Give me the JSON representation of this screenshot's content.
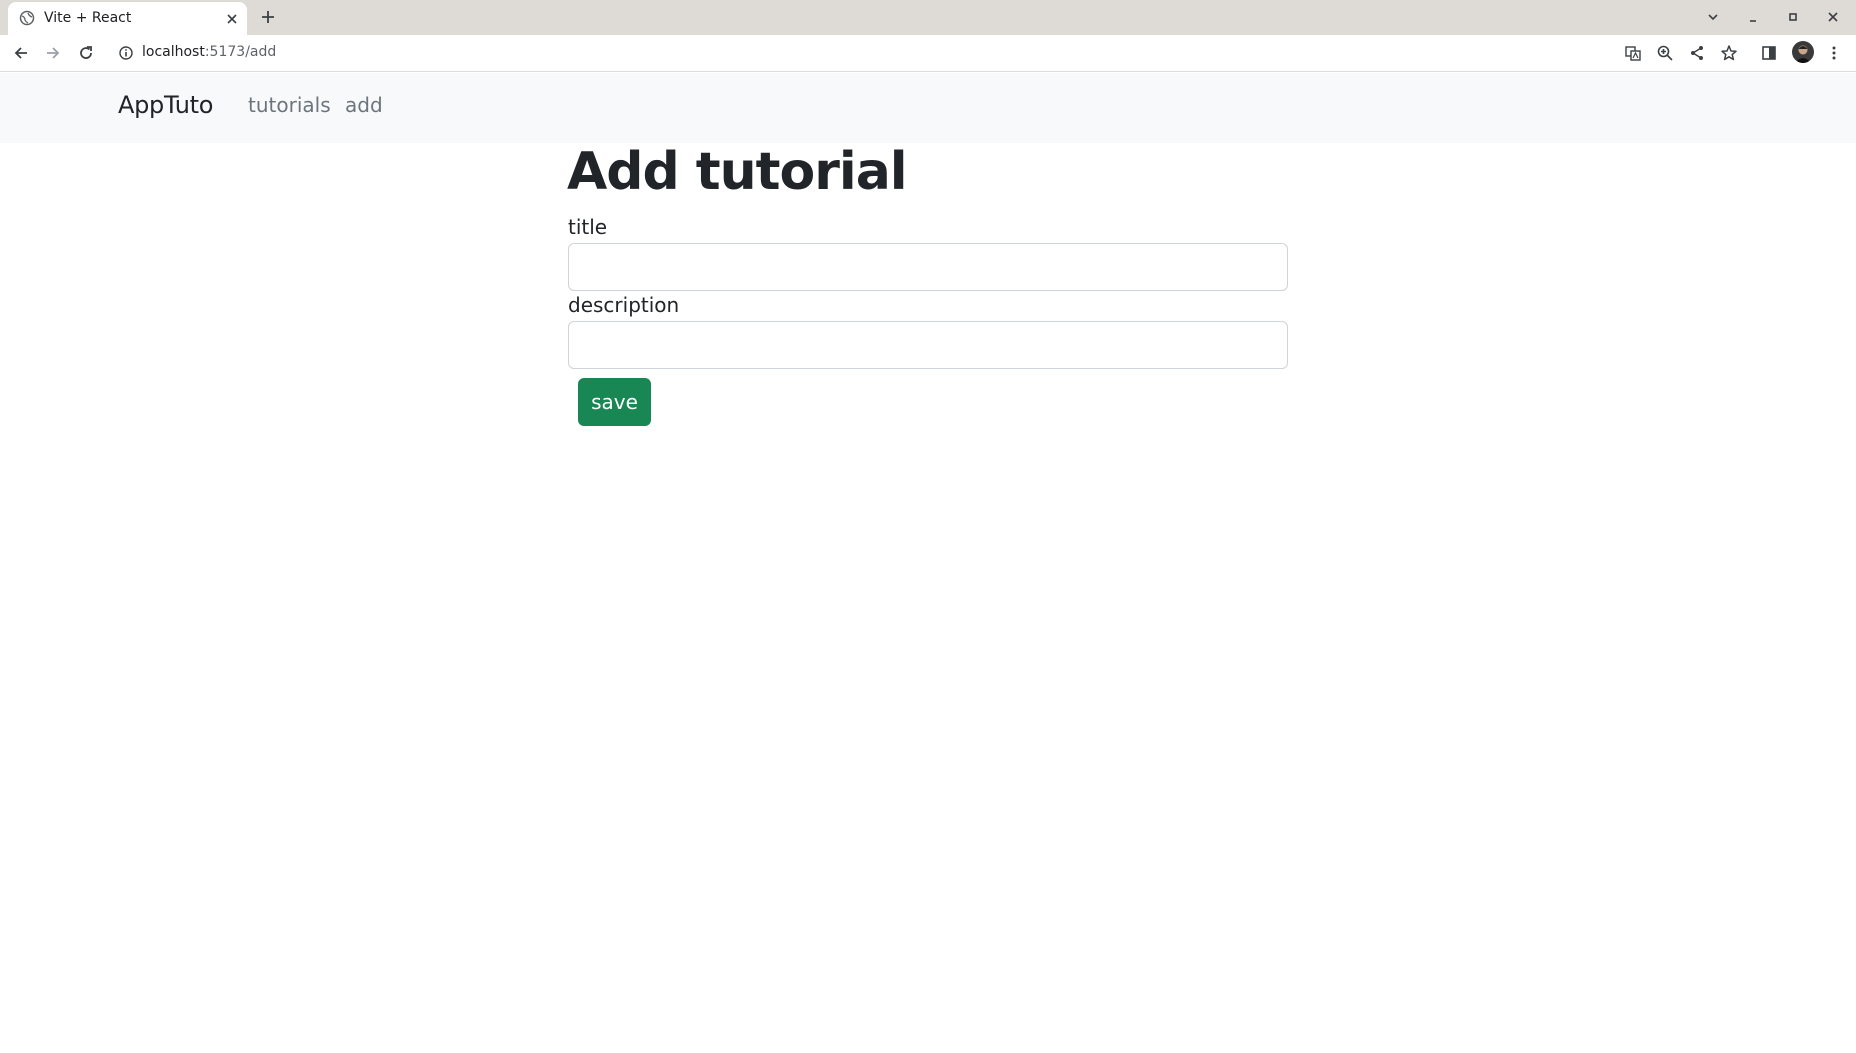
{
  "browser": {
    "tab_title": "Vite + React",
    "url_host": "localhost",
    "url_path": ":5173/add"
  },
  "navbar": {
    "brand": "AppTuto",
    "links": [
      {
        "label": "tutorials"
      },
      {
        "label": "add"
      }
    ]
  },
  "form": {
    "heading": "Add tutorial",
    "title_label": "title",
    "title_value": "",
    "description_label": "description",
    "description_value": "",
    "save_label": "save"
  },
  "colors": {
    "navbar_bg": "#f8f9fa",
    "save_button": "#198754",
    "nav_link": "#6c757d",
    "text": "#212529"
  },
  "icons": {
    "favicon": "globe-icon",
    "back": "arrow-left-icon",
    "forward": "arrow-right-icon",
    "reload": "reload-icon",
    "site_info": "info-icon",
    "translate": "translate-icon",
    "zoom": "zoom-icon",
    "share": "share-icon",
    "bookmark": "star-icon",
    "side_panel": "side-panel-icon",
    "menu": "kebab-menu-icon"
  }
}
